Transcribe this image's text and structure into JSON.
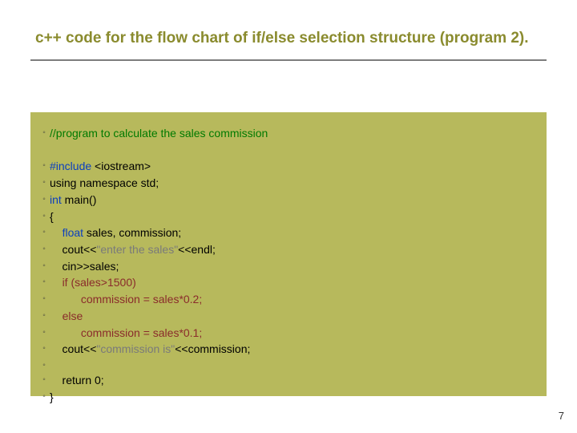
{
  "title": "c++ code for the flow chart of if/else selection structure (program 2).",
  "page_number": "7",
  "code": {
    "lines": [
      {
        "segs": [
          {
            "t": "//program to calculate the sales commission",
            "cls": "c-green"
          }
        ]
      },
      {
        "blank": true
      },
      {
        "segs": [
          {
            "t": "#include ",
            "cls": "c-blue"
          },
          {
            "t": "<iostream>",
            "cls": "c-black"
          }
        ]
      },
      {
        "segs": [
          {
            "t": "using namespace std;",
            "cls": "c-black"
          }
        ]
      },
      {
        "segs": [
          {
            "t": "int",
            "cls": "c-blue"
          },
          {
            "t": " main()",
            "cls": "c-black"
          }
        ]
      },
      {
        "segs": [
          {
            "t": "{",
            "cls": "c-black"
          }
        ]
      },
      {
        "segs": [
          {
            "t": "    ",
            "cls": "c-black"
          },
          {
            "t": "float",
            "cls": "c-blue"
          },
          {
            "t": " sales, commission;",
            "cls": "c-black"
          }
        ]
      },
      {
        "segs": [
          {
            "t": "    cout",
            "cls": "c-black"
          },
          {
            "t": "<<",
            "cls": "c-black"
          },
          {
            "t": "\"enter the sales\"",
            "cls": "c-gray"
          },
          {
            "t": "<<endl;",
            "cls": "c-black"
          }
        ]
      },
      {
        "segs": [
          {
            "t": "    cin>>sales;",
            "cls": "c-black"
          }
        ]
      },
      {
        "segs": [
          {
            "t": "    ",
            "cls": "c-black"
          },
          {
            "t": "if",
            "cls": "c-maroon"
          },
          {
            "t": " (sales>1500)",
            "cls": "c-maroon"
          }
        ]
      },
      {
        "segs": [
          {
            "t": "          commission = sales*0.2;",
            "cls": "c-maroon"
          }
        ]
      },
      {
        "segs": [
          {
            "t": "    ",
            "cls": "c-black"
          },
          {
            "t": "else",
            "cls": "c-maroon"
          }
        ]
      },
      {
        "segs": [
          {
            "t": "          commission = sales*0.1;",
            "cls": "c-maroon"
          }
        ]
      },
      {
        "segs": [
          {
            "t": "    cout",
            "cls": "c-black"
          },
          {
            "t": "<<",
            "cls": "c-black"
          },
          {
            "t": "\"commission is\"",
            "cls": "c-gray"
          },
          {
            "t": "<<commission;",
            "cls": "c-black"
          }
        ]
      },
      {
        "segs": [
          {
            "t": "",
            "cls": "c-black"
          }
        ]
      },
      {
        "segs": [
          {
            "t": "    return 0;",
            "cls": "c-black"
          }
        ]
      },
      {
        "segs": [
          {
            "t": "}",
            "cls": "c-black"
          }
        ]
      }
    ]
  }
}
